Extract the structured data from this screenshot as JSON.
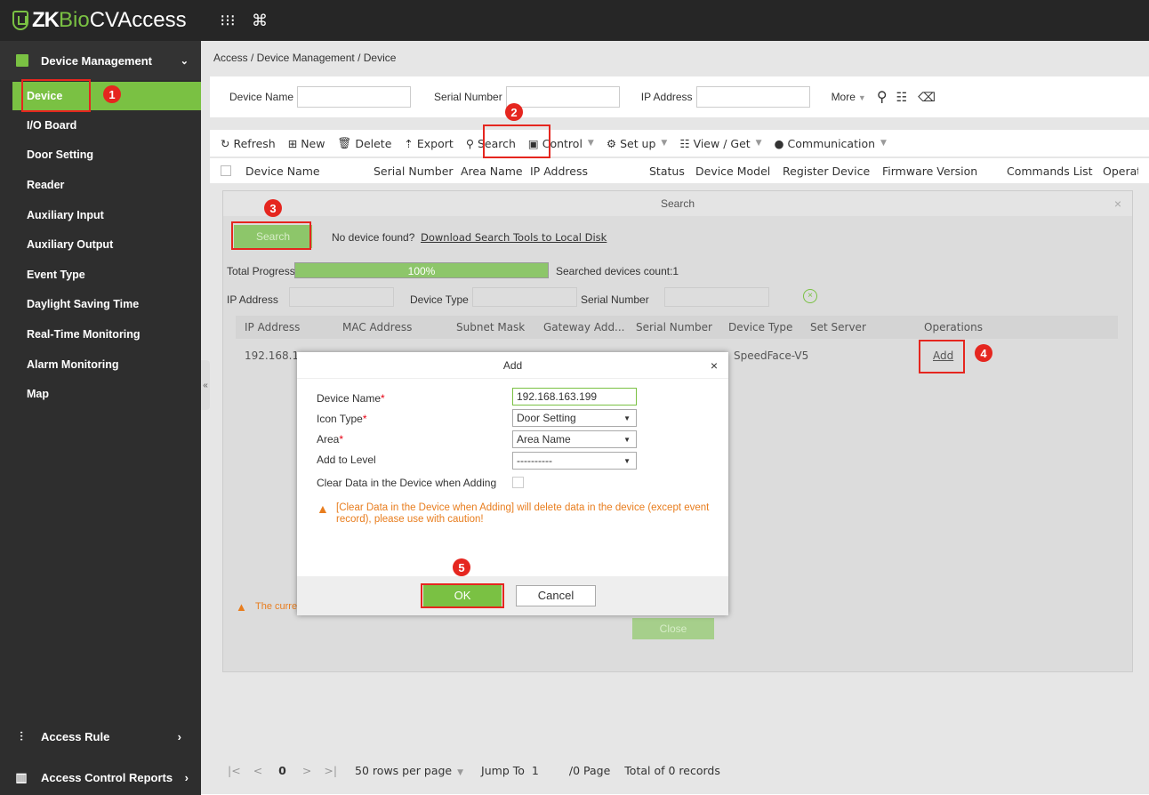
{
  "app": {
    "brand_zk": "ZK",
    "brand_bio": "Bio",
    "brand_rest": " CVAccess",
    "apps_icon": "grid-icon",
    "cmd_icon": "command-icon"
  },
  "sidebar": {
    "header": "Device Management",
    "items": [
      {
        "label": "Device",
        "active": true
      },
      {
        "label": "I/O Board"
      },
      {
        "label": "Door Setting"
      },
      {
        "label": "Reader"
      },
      {
        "label": "Auxiliary Input"
      },
      {
        "label": "Auxiliary Output"
      },
      {
        "label": "Event Type"
      },
      {
        "label": "Daylight Saving Time"
      },
      {
        "label": "Real-Time Monitoring"
      },
      {
        "label": "Alarm Monitoring"
      },
      {
        "label": "Map"
      }
    ],
    "bottom": [
      {
        "label": "Access Rule"
      },
      {
        "label": "Access Control Reports"
      }
    ],
    "collapse": "«"
  },
  "breadcrumb": "Access / Device Management / Device",
  "filter": {
    "device_name": "Device Name",
    "serial_number": "Serial Number",
    "ip_address": "IP Address",
    "more": "More"
  },
  "toolbar": {
    "refresh": "Refresh",
    "new": "New",
    "delete": "Delete",
    "export": "Export",
    "search": "Search",
    "control": "Control",
    "setup": "Set up",
    "view_get": "View / Get",
    "communication": "Communication"
  },
  "table_headers": [
    "Device Name",
    "Serial Number",
    "Area Name",
    "IP Address",
    "Status",
    "Device Model",
    "Register Device",
    "Firmware Version",
    "Commands List",
    "Operat"
  ],
  "search_dialog": {
    "title": "Search",
    "search_btn": "Search",
    "not_found": "No device found?",
    "download_link": "Download Search Tools to Local Disk",
    "total_progress": "Total Progress",
    "progress_text": "100%",
    "progress": 1.0,
    "searched_count": "Searched devices count:1",
    "ip_label": "IP Address",
    "device_type_label": "Device Type",
    "serial_label": "Serial Number",
    "columns": [
      "IP Address",
      "MAC Address",
      "Subnet Mask",
      "Gateway Add...",
      "Serial Number",
      "Device Type",
      "Set Server",
      "Operations"
    ],
    "row": {
      "ip": "192.168.1",
      "device_type": "SpeedFace-V5",
      "op": "Add"
    },
    "warning": "The curre",
    "close": "Close"
  },
  "add_dialog": {
    "title": "Add",
    "close": "×",
    "fields": [
      {
        "label": "Device Name",
        "required": "*",
        "value": "192.168.163.199"
      },
      {
        "label": "Icon Type",
        "required": "*",
        "value": "Door Setting"
      },
      {
        "label": "Area",
        "required": "*",
        "value": "Area Name"
      },
      {
        "label": "Add to Level",
        "required": "",
        "value": "----------"
      },
      {
        "label": "Clear Data in the Device when Adding",
        "required": ""
      }
    ],
    "warning": "[Clear Data in the Device when Adding] will delete data in the device (except event record), please use with caution!",
    "ok": "OK",
    "cancel": "Cancel"
  },
  "markers": [
    "1",
    "2",
    "3",
    "4",
    "5"
  ],
  "pagination": {
    "first": "|<",
    "prev": "<",
    "page": "0",
    "next": ">",
    "last": ">|",
    "rows": "50 rows per page",
    "jump": "Jump To",
    "jump_val": "1",
    "pages": "/0 Page",
    "total": "Total of 0 records"
  },
  "colors": {
    "accent": "#7ac143",
    "annotation": "#e5261f",
    "warning": "#e87d1e"
  }
}
